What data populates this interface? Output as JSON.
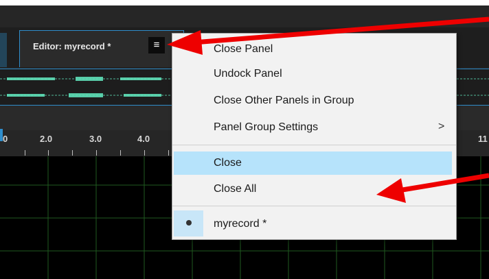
{
  "editor_tab": {
    "label": "Editor: myrecord *",
    "menu_icon": "hamburger-icon"
  },
  "timeline": {
    "ticks": [
      "0",
      "2.0",
      "3.0",
      "4.0",
      "11"
    ]
  },
  "panel_menu": {
    "items": [
      {
        "label": "Close Panel"
      },
      {
        "label": "Undock Panel"
      },
      {
        "label": "Close Other Panels in Group"
      },
      {
        "label": "Panel Group Settings",
        "submenu_arrow": ">"
      },
      {
        "label": "Close",
        "highlighted": true
      },
      {
        "label": "Close All"
      },
      {
        "label": "myrecord *",
        "checked": true
      }
    ]
  },
  "colors": {
    "accent": "#2f8ecc",
    "menu_highlight": "#b6e3fb",
    "annotation_arrow": "#ee0000",
    "waveform": "#5fe0b8",
    "grid": "#1f5a1f"
  }
}
